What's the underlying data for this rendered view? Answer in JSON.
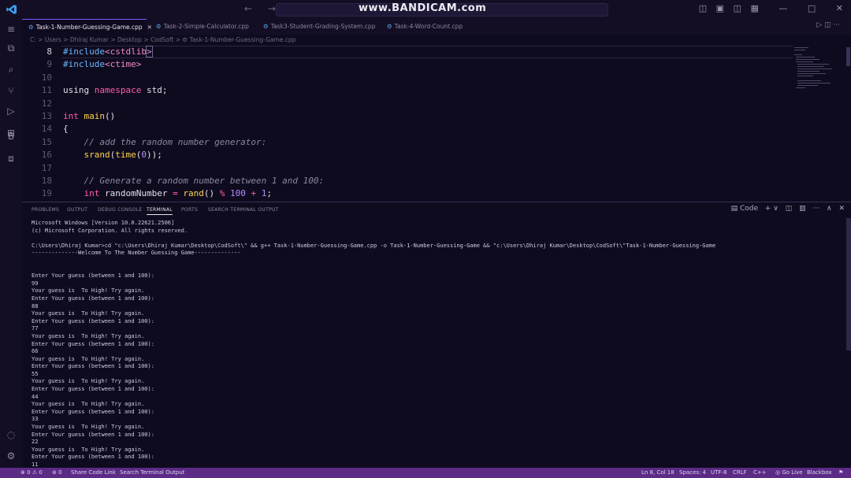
{
  "titlebar": {
    "watermark": "www.BANDICAM.com",
    "nav": "← →",
    "controls": [
      "◫",
      "▣",
      "◫",
      "▦",
      "—",
      "□",
      "✕"
    ]
  },
  "activity": {
    "icons": [
      "≡",
      "⧉",
      "⌕",
      "⑂",
      "▷",
      "⊞",
      "B",
      "⧈"
    ],
    "bottom_icons": [
      "◌",
      "⚙"
    ]
  },
  "tabs": [
    {
      "label": "Task-1-Number-Guessing-Game.cpp",
      "active": true
    },
    {
      "label": "Task-2-Simple-Calculator.cpp",
      "active": false
    },
    {
      "label": "Task3-Student-Grading-System.cpp",
      "active": false
    },
    {
      "label": "Task-4-Word-Count.cpp",
      "active": false
    }
  ],
  "editor_actions": "▷ ◫ ···",
  "breadcrumb": "C: > Users > Dhiraj Kumar > Desktop > CodSoft > ⚙ Task-1-Number-Guessing-Game.cpp",
  "code_lines": [
    {
      "n": "8",
      "current": true,
      "tokens": [
        [
          "pp",
          "#include"
        ],
        [
          "inc",
          "<cstdlib"
        ],
        [
          "inc box",
          ">"
        ]
      ]
    },
    {
      "n": "9",
      "tokens": [
        [
          "pp",
          "#include"
        ],
        [
          "inc",
          "<ctime>"
        ]
      ]
    },
    {
      "n": "10",
      "tokens": []
    },
    {
      "n": "11",
      "tokens": [
        [
          "tx",
          "using "
        ],
        [
          "kw",
          "namespace"
        ],
        [
          "tx",
          " std;"
        ]
      ]
    },
    {
      "n": "12",
      "tokens": []
    },
    {
      "n": "13",
      "tokens": [
        [
          "kw",
          "int"
        ],
        [
          "tx",
          " "
        ],
        [
          "fn",
          "main"
        ],
        [
          "tx",
          "()"
        ]
      ]
    },
    {
      "n": "14",
      "tokens": [
        [
          "tx",
          "{"
        ]
      ]
    },
    {
      "n": "15",
      "tokens": [
        [
          "tx",
          "    "
        ],
        [
          "cm",
          "// add the random number generator:"
        ]
      ]
    },
    {
      "n": "16",
      "tokens": [
        [
          "tx",
          "    "
        ],
        [
          "fn",
          "srand"
        ],
        [
          "tx",
          "("
        ],
        [
          "fn",
          "time"
        ],
        [
          "tx",
          "("
        ],
        [
          "num",
          "0"
        ],
        [
          "tx",
          "));"
        ]
      ]
    },
    {
      "n": "17",
      "tokens": []
    },
    {
      "n": "18",
      "tokens": [
        [
          "tx",
          "    "
        ],
        [
          "cm",
          "// Generate a random number between 1 and 100:"
        ]
      ]
    },
    {
      "n": "19",
      "tokens": [
        [
          "tx",
          "    "
        ],
        [
          "kw",
          "int"
        ],
        [
          "tx",
          " randomNumber "
        ],
        [
          "kw",
          "="
        ],
        [
          "tx",
          " "
        ],
        [
          "fn",
          "rand"
        ],
        [
          "tx",
          "() "
        ],
        [
          "kw",
          "%"
        ],
        [
          "tx",
          " "
        ],
        [
          "num",
          "100"
        ],
        [
          "tx",
          " "
        ],
        [
          "kw",
          "+"
        ],
        [
          "tx",
          " "
        ],
        [
          "num",
          "1"
        ],
        [
          "tx",
          ";"
        ]
      ]
    }
  ],
  "panel": {
    "tabs": [
      "PROBLEMS",
      "OUTPUT",
      "DEBUG CONSOLE",
      "TERMINAL",
      "PORTS",
      "SEARCH TERMINAL OUTPUT"
    ],
    "active_tab": "TERMINAL",
    "actions": [
      "▤ Code",
      "+ ∨",
      "◫",
      "▥",
      "···",
      "∧",
      "✕"
    ]
  },
  "terminal_lines": [
    "Microsoft Windows [Version 10.0.22621.2506]",
    "(c) Microsoft Corporation. All rights reserved.",
    "",
    "C:\\Users\\Dhiraj Kumar>cd \"c:\\Users\\Dhiraj Kumar\\Desktop\\CodSoft\\\" && g++ Task-1-Number-Guessing-Game.cpp -o Task-1-Number-Guessing-Game && \"c:\\Users\\Dhiraj Kumar\\Desktop\\CodSoft\\\"Task-1-Number-Guessing-Game",
    "--------------Welcome To The Number Guessing Game--------------",
    "",
    "",
    "Enter Your guess (between 1 and 100):",
    "99",
    "Your guess is  To High! Try again.",
    "Enter Your guess (between 1 and 100):",
    "88",
    "Your guess is  To High! Try again.",
    "Enter Your guess (between 1 and 100):",
    "77",
    "Your guess is  To High! Try again.",
    "Enter Your guess (between 1 and 100):",
    "66",
    "Your guess is  To High! Try again.",
    "Enter Your guess (between 1 and 100):",
    "55",
    "Your guess is  To High! Try again.",
    "Enter Your guess (between 1 and 100):",
    "44",
    "Your guess is  To High! Try again.",
    "Enter Your guess (between 1 and 100):",
    "33",
    "Your guess is  To High! Try again.",
    "Enter Your guess (between 1 and 100):",
    "22",
    "Your guess is  To High! Try again.",
    "Enter Your guess (between 1 and 100):",
    "11"
  ],
  "statusbar": {
    "left": [
      "⊗ 0 ⚠ 0",
      "⊚ 0",
      "Share Code Link",
      "Search Terminal Output"
    ],
    "right": [
      "Ln 8, Col 18",
      "Spaces: 4",
      "UTF-8",
      "CRLF",
      "C++",
      "◎ Go Live",
      "Blackbox",
      "⚑"
    ]
  }
}
